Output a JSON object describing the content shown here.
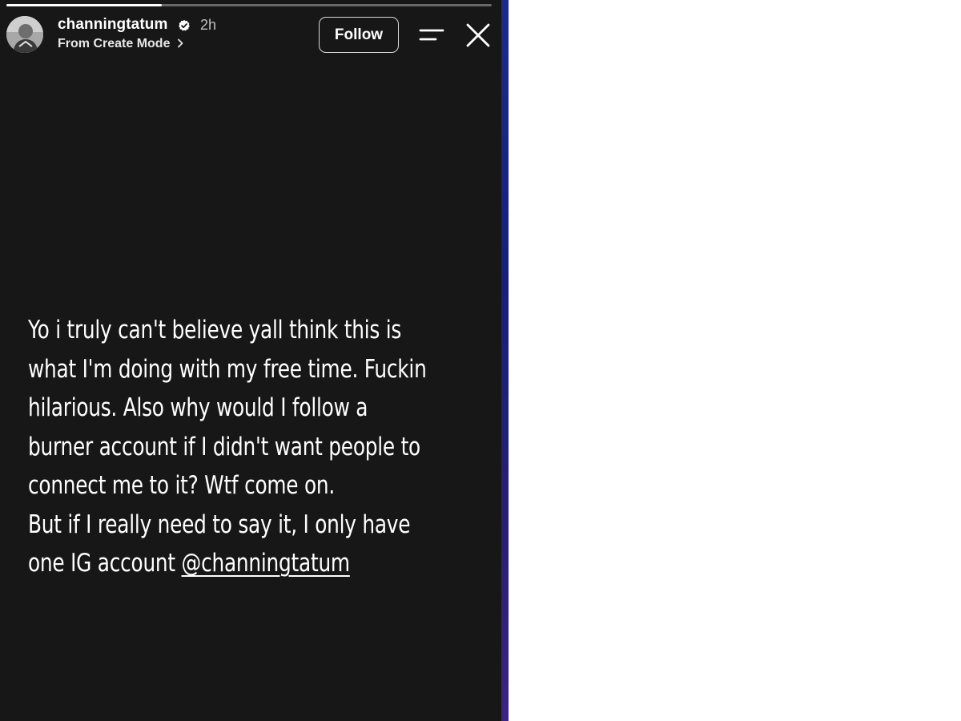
{
  "story": {
    "progress": 0.32,
    "header": {
      "username": "channingtatum",
      "verified": true,
      "time_ago": "2h",
      "subtitle": "From Create Mode",
      "follow_label": "Follow"
    },
    "text": {
      "lines": [
        "Yo i truly can't believe yall think this is",
        "what I'm doing with my free time. Fuckin",
        "hilarious. Also why would I follow a",
        "burner account if I didn't want people to",
        "connect me to it? Wtf come on.",
        "But if I really need to say it, I only have"
      ],
      "last_line_prefix": "one IG account ",
      "mention": "@channingtatum"
    }
  },
  "icons": {
    "verified": "verified-badge-icon",
    "chevron": "chevron-right-icon",
    "menu": "menu-lines-icon",
    "close": "close-icon"
  },
  "colors": {
    "story_background": "#171717",
    "text": "#ffffff",
    "edge_strip": "#1b2a8c",
    "page_background": "#ffffff"
  }
}
